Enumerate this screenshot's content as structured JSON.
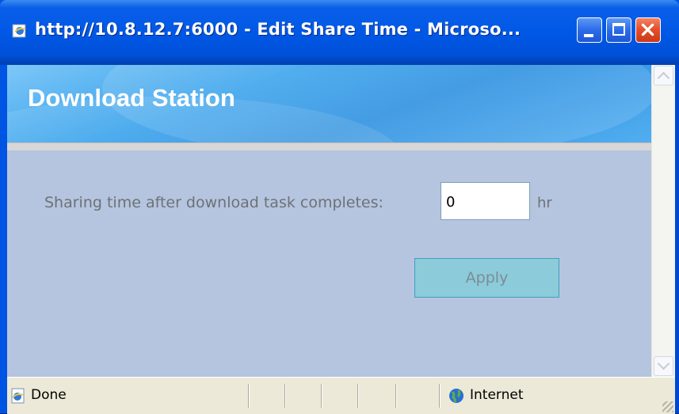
{
  "window": {
    "title": "http://10.8.12.7:6000 - Edit Share Time - Microso...",
    "title_icon": "ie-page-icon",
    "buttons": [
      "minimize",
      "maximize",
      "close"
    ]
  },
  "banner": {
    "title": "Download Station"
  },
  "form": {
    "share_label": "Sharing time after download task completes:",
    "share_value": "0",
    "unit": "hr",
    "apply_label": "Apply"
  },
  "status": {
    "text": "Done",
    "zone": "Internet",
    "zone_icon": "globe-icon"
  },
  "colors": {
    "titlebar": "#0058e6",
    "client_bg": "#b5c5df",
    "banner": "#2b8fe0",
    "apply_button": "#8ccbd9",
    "close_button": "#e5502b"
  }
}
